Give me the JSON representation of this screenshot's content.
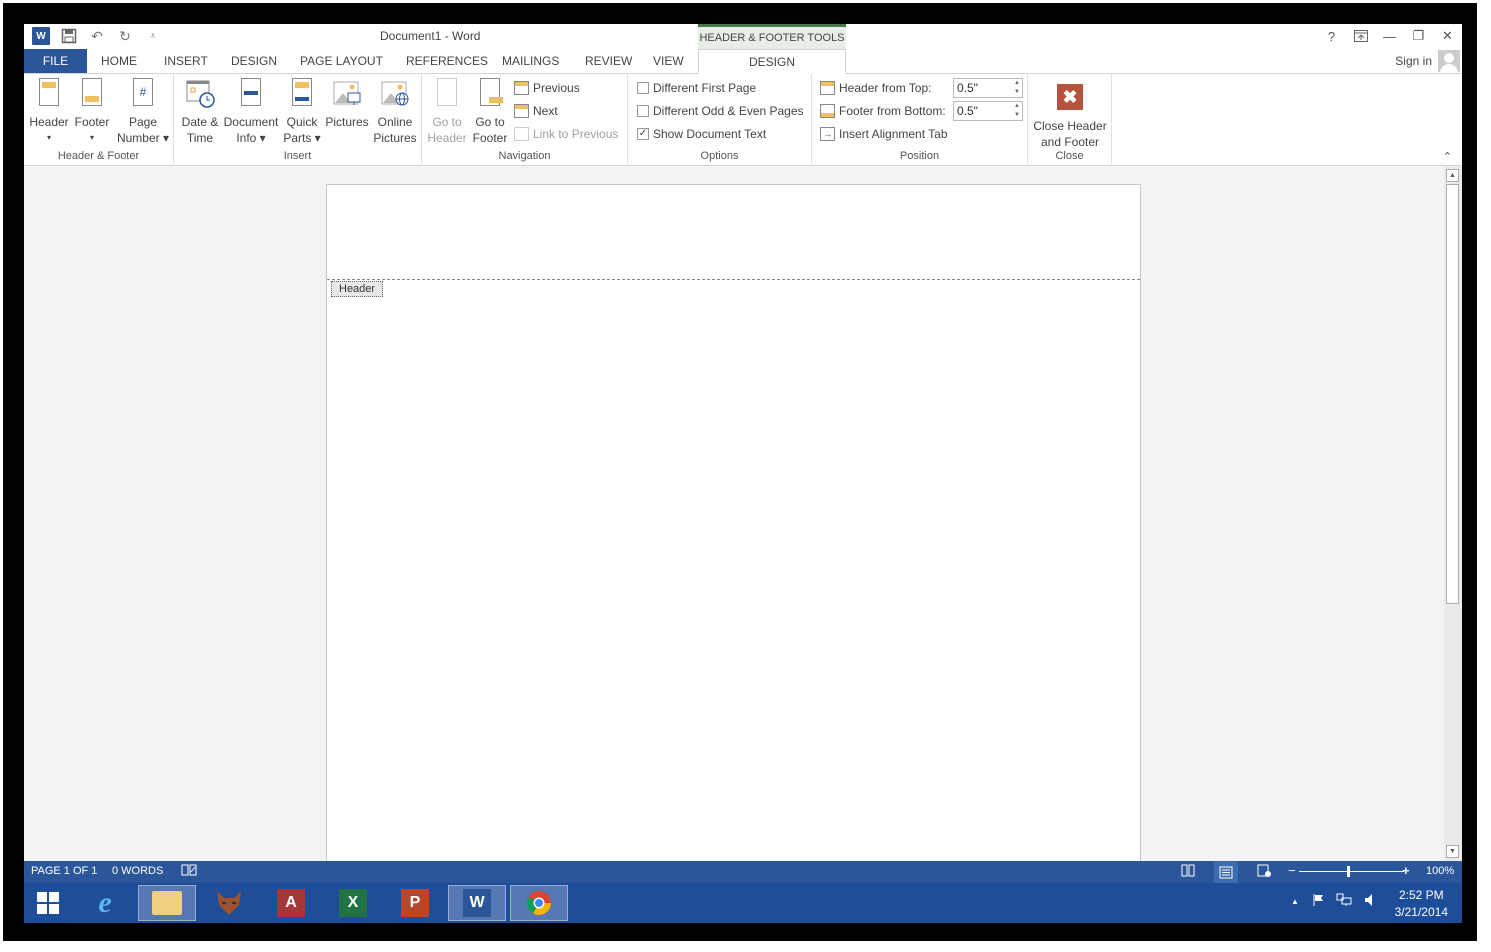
{
  "window": {
    "title": "Document1 - Word",
    "context_tab_group": "HEADER & FOOTER TOOLS",
    "controls": {
      "help": "?",
      "ribbon_display": "⬆",
      "minimize": "—",
      "restore": "❐",
      "close": "✕"
    },
    "sign_in": "Sign in"
  },
  "quick_access": {
    "word_icon": "W",
    "save_icon": "💾",
    "undo_icon": "↶",
    "undo_dropdown": "▾",
    "redo_icon": "↻",
    "customize_icon": "⩡"
  },
  "tabs": [
    {
      "label": "FILE"
    },
    {
      "label": "HOME"
    },
    {
      "label": "INSERT"
    },
    {
      "label": "DESIGN"
    },
    {
      "label": "PAGE LAYOUT"
    },
    {
      "label": "REFERENCES"
    },
    {
      "label": "MAILINGS"
    },
    {
      "label": "REVIEW"
    },
    {
      "label": "VIEW"
    },
    {
      "label": "DESIGN",
      "active": true
    }
  ],
  "ribbon": {
    "header_footer": {
      "label": "Header & Footer",
      "header": {
        "line1": "Header",
        "line2": "▾"
      },
      "footer": {
        "line1": "Footer",
        "line2": "▾"
      },
      "page_number": {
        "line1": "Page",
        "line2": "Number ▾"
      }
    },
    "insert": {
      "label": "Insert",
      "date_time": {
        "line1": "Date &",
        "line2": "Time"
      },
      "document_info": {
        "line1": "Document",
        "line2": "Info ▾"
      },
      "quick_parts": {
        "line1": "Quick",
        "line2": "Parts ▾"
      },
      "pictures": {
        "line1": "Pictures",
        "line2": ""
      },
      "online_pictures": {
        "line1": "Online",
        "line2": "Pictures"
      }
    },
    "navigation": {
      "label": "Navigation",
      "go_to_header": {
        "line1": "Go to",
        "line2": "Header"
      },
      "go_to_footer": {
        "line1": "Go to",
        "line2": "Footer"
      },
      "previous": "Previous",
      "next": "Next",
      "link_to_previous": "Link to Previous"
    },
    "options": {
      "label": "Options",
      "different_first_page": {
        "label": "Different First Page",
        "checked": false
      },
      "different_odd_even": {
        "label": "Different Odd & Even Pages",
        "checked": false
      },
      "show_document_text": {
        "label": "Show Document Text",
        "checked": true,
        "mark": "✓"
      }
    },
    "position": {
      "label": "Position",
      "header_from_top": {
        "label": "Header from Top:",
        "value": "0.5\""
      },
      "footer_from_bottom": {
        "label": "Footer from Bottom:",
        "value": "0.5\""
      },
      "insert_alignment_tab": "Insert Alignment Tab"
    },
    "close": {
      "label": "Close",
      "button": {
        "line1": "Close Header",
        "line2": "and Footer",
        "icon": "✖"
      }
    },
    "collapse_icon": "⌃"
  },
  "document": {
    "header_tag": "Header"
  },
  "statusbar": {
    "page": "PAGE 1 OF 1",
    "words": "0 WORDS",
    "proofing_icon": "📖",
    "zoom_minus": "−",
    "zoom_plus": "+",
    "zoom": "100%",
    "zoom_level_percent": 100
  },
  "taskbar": {
    "apps": [
      {
        "name": "Internet Explorer",
        "glyph": "e"
      },
      {
        "name": "File Explorer",
        "glyph": "📁"
      },
      {
        "name": "Fox app",
        "glyph": "🦊"
      },
      {
        "name": "Access",
        "glyph": "A"
      },
      {
        "name": "Excel",
        "glyph": "X"
      },
      {
        "name": "PowerPoint",
        "glyph": "P"
      },
      {
        "name": "Word",
        "glyph": "W",
        "active": true
      },
      {
        "name": "Chrome",
        "glyph": "◉"
      }
    ],
    "time": "2:52 PM",
    "date": "3/21/2014"
  },
  "colors": {
    "accent": "#2b579a",
    "context_green": "#4a7a4a",
    "close_red": "#b5533c",
    "taskbar": "#1e4d9a"
  }
}
